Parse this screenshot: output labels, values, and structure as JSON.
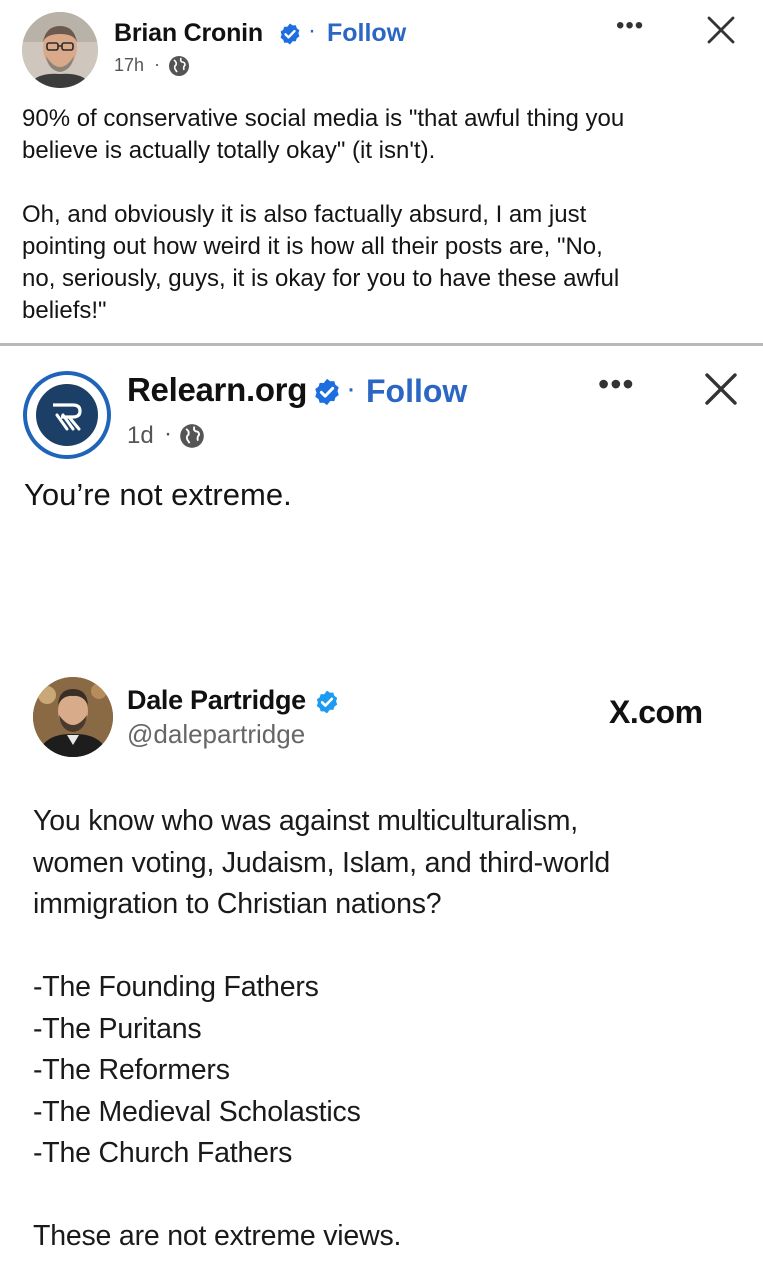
{
  "post": {
    "author": "Brian Cronin",
    "follow_label": "Follow",
    "separator": "·",
    "time": "17h",
    "more_label": "•••",
    "body": [
      "90% of conservative social media is \"that awful thing you",
      "believe is actually totally okay\" (it isn't).",
      "",
      "Oh, and obviously it is also factually absurd, I am just",
      "pointing out how weird it is how all their posts are, \"No,",
      "no, seriously, guys, it is okay for you to have these awful",
      "beliefs!\""
    ]
  },
  "shared": {
    "author": "Relearn.org",
    "follow_label": "Follow",
    "separator": "·",
    "time": "1d",
    "more_label": "•••",
    "caption": "You’re not extreme."
  },
  "tweet": {
    "author": "Dale Partridge",
    "handle": "@dalepartridge",
    "source": "X.com",
    "lines": [
      "You know who was against multiculturalism,",
      "women voting, Judaism, Islam, and third-world",
      "immigration to Christian nations?",
      "",
      "-The Founding Fathers",
      "-The Puritans",
      "-The Reformers",
      "-The Medieval Scholastics",
      "-The Church Fathers",
      "",
      "These are not extreme views."
    ]
  },
  "colors": {
    "link_blue": "#2b66c5",
    "verified_blue": "#1d6fe0",
    "divider": "#b8b8b8",
    "logo_navy": "#1c3f67"
  },
  "icons": {
    "verified": "verified-badge-icon",
    "globe": "globe-icon",
    "close": "close-icon",
    "more": "more-options-icon"
  }
}
